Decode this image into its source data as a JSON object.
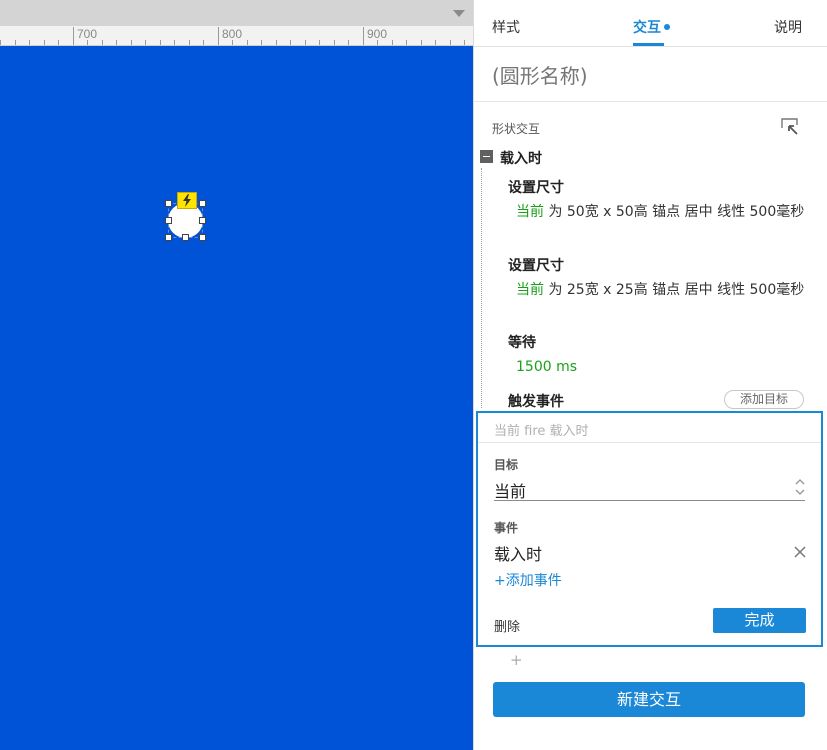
{
  "ruler": {
    "labels": [
      "700",
      "800",
      "900"
    ]
  },
  "tabs": [
    {
      "label": "样式"
    },
    {
      "label": "交互"
    },
    {
      "label": "说明"
    }
  ],
  "shape_name": {
    "placeholder": "(圆形名称)"
  },
  "section": {
    "label": "形状交互"
  },
  "event": {
    "name": "载入时",
    "actions": [
      {
        "title": "设置尺寸",
        "target": "当前",
        "detail": " 为 50宽 x 50高  锚点 居中 线性 500毫秒"
      },
      {
        "title": "设置尺寸",
        "target": "当前",
        "detail": " 为 25宽 x 25高  锚点 居中 线性 500毫秒"
      },
      {
        "title": "等待",
        "value": "1500 ms"
      },
      {
        "title": "触发事件",
        "add_target_label": "添加目标"
      }
    ]
  },
  "edit": {
    "summary": "当前 fire 载入时",
    "target_label": "目标",
    "target_value": "当前",
    "event_label": "事件",
    "event_value": "载入时",
    "add_event_label": "+添加事件",
    "delete_label": "删除",
    "done_label": "完成"
  },
  "add_plus": "+",
  "new_interaction_label": "新建交互",
  "colors": {
    "canvas": "#0052d6",
    "accent": "#1a88d6",
    "action_target": "#1aa01a",
    "lightning_badge": "#ffe400"
  }
}
